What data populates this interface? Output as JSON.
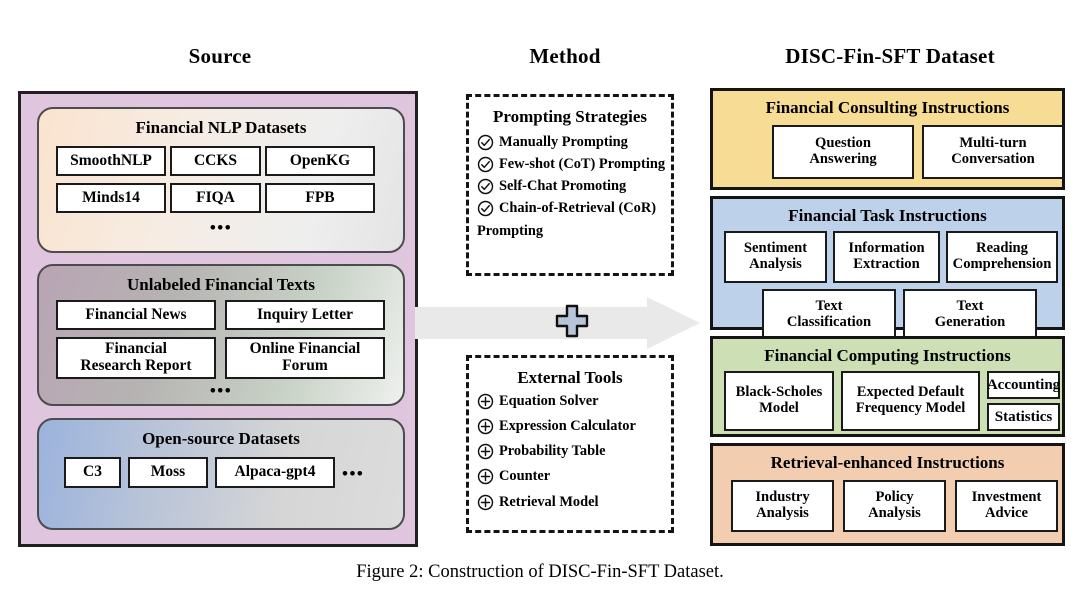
{
  "figure": {
    "caption": "Figure 2: Construction of DISC-Fin-SFT Dataset."
  },
  "columns": {
    "source_title": "Source",
    "method_title": "Method",
    "dataset_title": "DISC-Fin-SFT Dataset"
  },
  "source": {
    "groups": [
      {
        "title": "Financial NLP Datasets",
        "items": [
          "SmoothNLP",
          "CCKS",
          "OpenKG",
          "Minds14",
          "FIQA",
          "FPB"
        ],
        "ellipsis": "•••"
      },
      {
        "title": "Unlabeled Financial Texts",
        "items": [
          "Financial News",
          "Inquiry Letter",
          "Financial\nResearch Report",
          "Online Financial\nForum"
        ],
        "ellipsis": "•••"
      },
      {
        "title": "Open-source Datasets",
        "items": [
          "C3",
          "Moss",
          "Alpaca-gpt4"
        ],
        "ellipsis": "•••"
      }
    ]
  },
  "method": {
    "prompting": {
      "title": "Prompting Strategies",
      "icon": "check-circle-icon",
      "items": [
        "Manually Prompting",
        "Few-shot (CoT) Prompting",
        "Self-Chat Promoting",
        "Chain-of-Retrieval (CoR)"
      ],
      "continuation": "Prompting"
    },
    "tools": {
      "title": "External Tools",
      "icon": "plus-circle-icon",
      "items": [
        "Equation Solver",
        "Expression Calculator",
        "Probability Table",
        "Counter",
        "Retrieval Model"
      ]
    },
    "arrow": {
      "name": "flow-arrow",
      "badge": "plus-badge"
    }
  },
  "dataset": {
    "panels": [
      {
        "title": "Financial Consulting Instructions",
        "color": "#f7dc95",
        "items": [
          "Question\nAnswering",
          "Multi-turn\nConversation"
        ]
      },
      {
        "title": "Financial Task Instructions",
        "color": "#bdd2ea",
        "items": [
          "Sentiment\nAnalysis",
          "Information\nExtraction",
          "Reading\nComprehension",
          "Text\nClassification",
          "Text\nGeneration"
        ]
      },
      {
        "title": "Financial Computing Instructions",
        "color": "#ccdfb5",
        "items": [
          "Black-Scholes\nModel",
          "Expected Default\nFrequency Model",
          "Accounting",
          "Statistics"
        ]
      },
      {
        "title": "Retrieval-enhanced Instructions",
        "color": "#f2cdb0",
        "items": [
          "Industry\nAnalysis",
          "Policy\nAnalysis",
          "Investment\nAdvice"
        ]
      }
    ]
  },
  "colors": {
    "source_panel": "#dfc5de",
    "arrow": "#e9e9e9",
    "plus_badge": "#b8c4d8",
    "outline": "#141414"
  }
}
